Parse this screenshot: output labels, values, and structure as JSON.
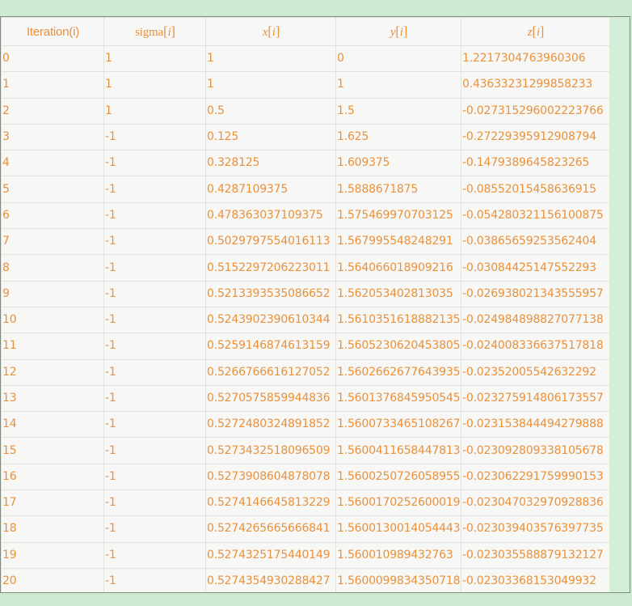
{
  "table": {
    "headers": {
      "iteration": "Iteration(i)",
      "sigma": {
        "name": "sigma",
        "index": "i"
      },
      "x": {
        "name": "x",
        "index": "i"
      },
      "y": {
        "name": "y",
        "index": "i"
      },
      "z": {
        "name": "z",
        "index": "i"
      }
    },
    "rows": [
      [
        "0",
        "1",
        "1",
        "0",
        "1.2217304763960306"
      ],
      [
        "1",
        "1",
        "1",
        "1",
        "0.43633231299858233"
      ],
      [
        "2",
        "1",
        "0.5",
        "1.5",
        "-0.027315296002223766"
      ],
      [
        "3",
        "-1",
        "0.125",
        "1.625",
        "-0.27229395912908794"
      ],
      [
        "4",
        "-1",
        "0.328125",
        "1.609375",
        "-0.1479389645823265"
      ],
      [
        "5",
        "-1",
        "0.4287109375",
        "1.5888671875",
        "-0.08552015458636915"
      ],
      [
        "6",
        "-1",
        "0.478363037109375",
        "1.575469970703125",
        "-0.054280321156100875"
      ],
      [
        "7",
        "-1",
        "0.5029797554016113",
        "1.567995548248291",
        "-0.03865659253562404"
      ],
      [
        "8",
        "-1",
        "0.5152297206223011",
        "1.564066018909216",
        "-0.03084425147552293"
      ],
      [
        "9",
        "-1",
        "0.5213393535086652",
        "1.562053402813035",
        "-0.026938021343555957"
      ],
      [
        "10",
        "-1",
        "0.5243902390610344",
        "1.5610351618882135",
        "-0.024984898827077138"
      ],
      [
        "11",
        "-1",
        "0.5259146874613159",
        "1.5605230620453805",
        "-0.024008336637517818"
      ],
      [
        "12",
        "-1",
        "0.5266766616127052",
        "1.5602662677643935",
        "-0.02352005542632292"
      ],
      [
        "13",
        "-1",
        "0.5270575859944836",
        "1.5601376845950545",
        "-0.023275914806173557"
      ],
      [
        "14",
        "-1",
        "0.5272480324891852",
        "1.5600733465108267",
        "-0.023153844494279888"
      ],
      [
        "15",
        "-1",
        "0.5273432518096509",
        "1.5600411658447813",
        "-0.023092809338105678"
      ],
      [
        "16",
        "-1",
        "0.5273908604878078",
        "1.5600250726058955",
        "-0.023062291759990153"
      ],
      [
        "17",
        "-1",
        "0.5274146645813229",
        "1.5600170252600019",
        "-0.023047032970928836"
      ],
      [
        "18",
        "-1",
        "0.5274265665666841",
        "1.5600130014054443",
        "-0.023039403576397735"
      ],
      [
        "19",
        "-1",
        "0.5274325175440149",
        "1.560010989432763",
        "-0.023035588879132127"
      ],
      [
        "20",
        "-1",
        "0.5274354930288427",
        "1.5600099834350718",
        "-0.02303368153049932"
      ]
    ]
  }
}
